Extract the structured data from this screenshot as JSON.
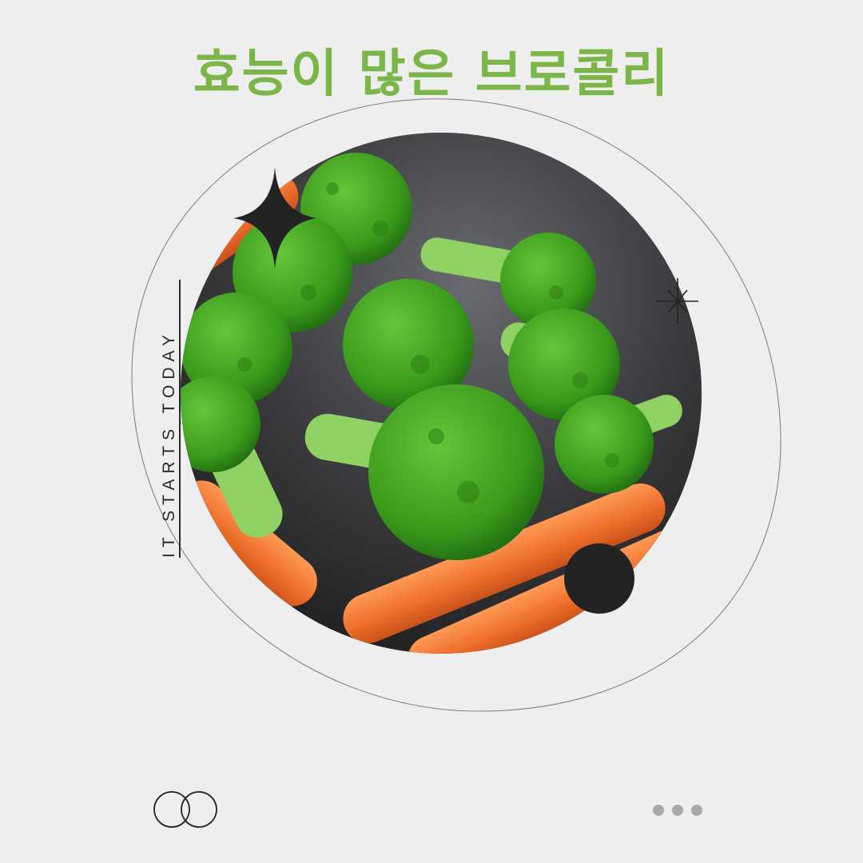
{
  "title": "효능이 많은 브로콜리",
  "side_text": "IT STARTS TODAY",
  "colors": {
    "background": "#eeeeee",
    "title": "#7ab648",
    "accent_dark": "#232323",
    "broccoli": "#3f9a1c",
    "carrot": "#ef7a31"
  },
  "icons": {
    "sparkle_large": "four-point-star-icon",
    "sparkle_small": "asterisk-star-icon",
    "rings": "interlocking-rings-icon",
    "dots": "three-dots-icon"
  }
}
